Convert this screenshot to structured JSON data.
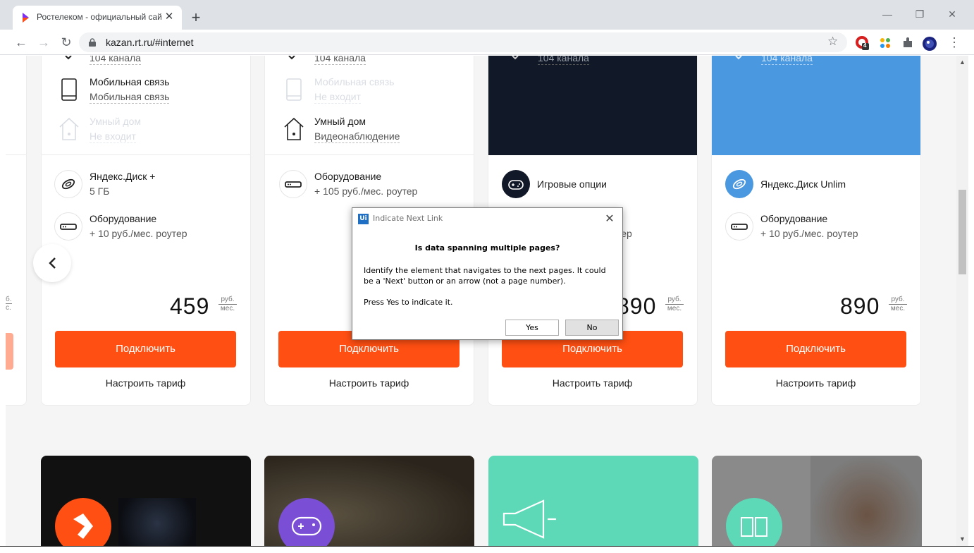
{
  "browser": {
    "tab_title": "Ростелеком - официальный сай",
    "url": "kazan.rt.ru/#internet",
    "ext_badge": "4"
  },
  "cards_top": [
    {
      "features": [
        {
          "title": "104 канала",
          "sub": ""
        },
        {
          "title": "Мобильная связь",
          "sub": "Мобильная связь"
        },
        {
          "title": "Умный дом",
          "sub": "Не входит"
        }
      ],
      "options": [
        {
          "title": "Яндекс.Диск +",
          "sub": "5 ГБ"
        },
        {
          "title": "Оборудование",
          "sub": "+ 10 руб./мес. роутер"
        }
      ],
      "price": "459",
      "currency_top": "руб.",
      "currency_bottom": "мес.",
      "connect": "Подключить",
      "configure": "Настроить тариф"
    },
    {
      "features": [
        {
          "title": "104 канала",
          "sub": ""
        },
        {
          "title": "Мобильная связь",
          "sub": "Не входит"
        },
        {
          "title": "Умный дом",
          "sub": "Видеонаблюдение"
        }
      ],
      "options": [
        {
          "title": "Оборудование",
          "sub": "+ 105 руб./мес. роутер"
        }
      ],
      "connect": "Подключить",
      "configure": "Настроить тариф"
    },
    {
      "features": [
        {
          "title": "104 канала",
          "sub": ""
        }
      ],
      "options": [
        {
          "title": "Игровые опции",
          "sub": ""
        },
        {
          "title": "",
          "sub": "тер"
        }
      ],
      "price": "890",
      "currency_top": "руб.",
      "currency_bottom": "мес.",
      "connect": "Подключить",
      "configure": "Настроить тариф"
    },
    {
      "features": [
        {
          "title": "104 канала",
          "sub": ""
        }
      ],
      "options": [
        {
          "title": "Яндекс.Диск Unlim",
          "sub": ""
        },
        {
          "title": "Оборудование",
          "sub": "+ 10 руб./мес. роутер"
        }
      ],
      "price": "890",
      "currency_top": "руб.",
      "currency_bottom": "мес.",
      "connect": "Подключить",
      "configure": "Настроить тариф"
    }
  ],
  "left_partial_currency": {
    "top": "б.",
    "bottom": "с."
  },
  "dialog": {
    "logo": "Ui",
    "title": "Indicate Next Link",
    "question": "Is data spanning multiple pages?",
    "message": "Identify the element that navigates to the next pages. It could be a 'Next' button or an arrow (not a page number).",
    "instruction": "Press Yes to indicate it.",
    "yes": "Yes",
    "no": "No"
  },
  "colors": {
    "accent": "#ff4f12",
    "dark_card": "#111827",
    "blue_card": "#4a98e0",
    "teal_card": "#5dd9b8"
  }
}
